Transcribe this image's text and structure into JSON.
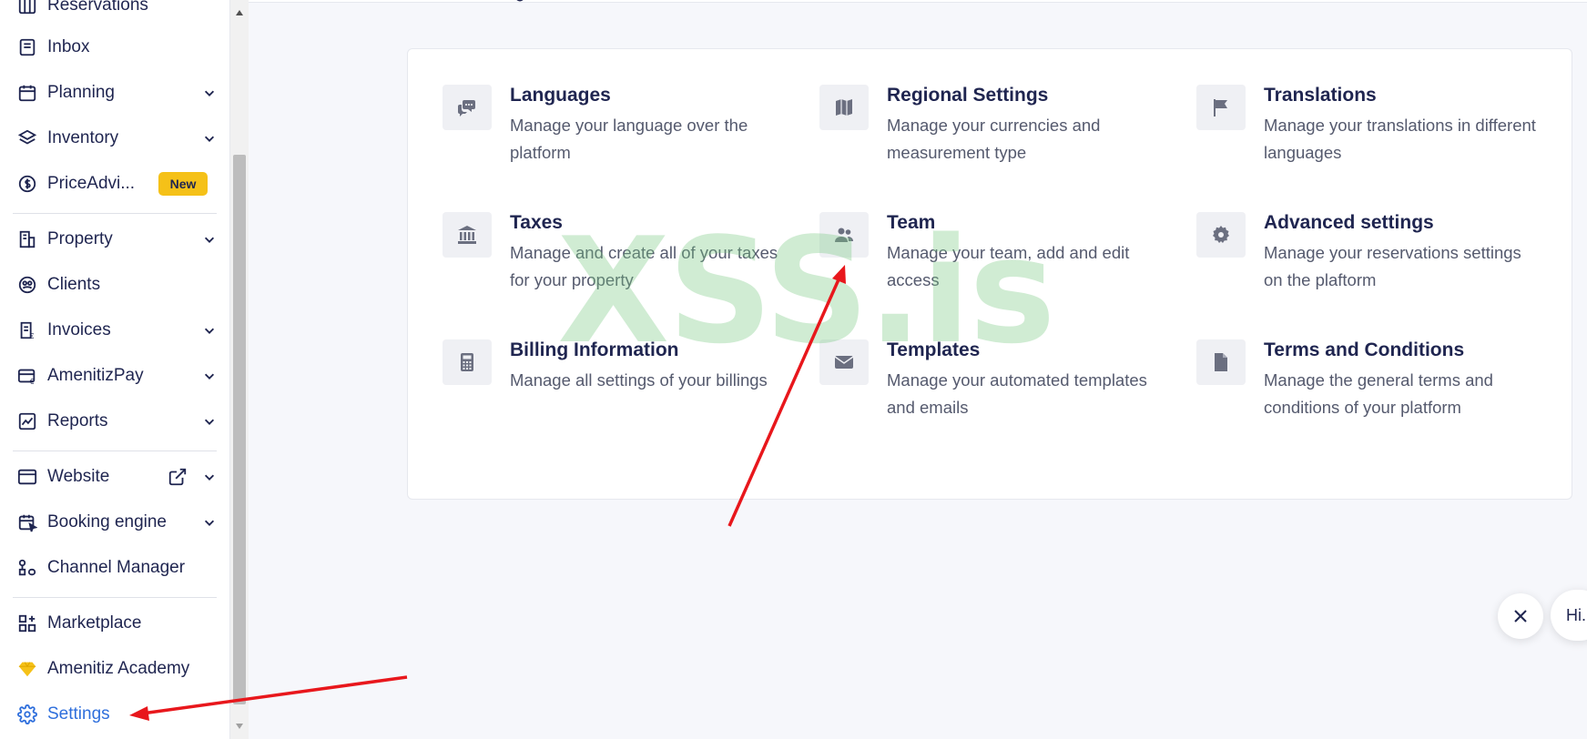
{
  "sidebar": {
    "items": [
      {
        "label": "Reservations",
        "icon": "reservations-icon"
      },
      {
        "label": "Inbox",
        "icon": "inbox-icon"
      },
      {
        "label": "Planning",
        "icon": "calendar-icon"
      },
      {
        "label": "Inventory",
        "icon": "layers-icon"
      },
      {
        "label": "PriceAdvi...",
        "icon": "dollar-circle-icon",
        "badge": "New"
      },
      {
        "label": "Property",
        "icon": "building-icon"
      },
      {
        "label": "Clients",
        "icon": "clients-icon"
      },
      {
        "label": "Invoices",
        "icon": "invoice-icon"
      },
      {
        "label": "AmenitizPay",
        "icon": "card-euro-icon"
      },
      {
        "label": "Reports",
        "icon": "chart-icon"
      },
      {
        "label": "Website",
        "icon": "browser-icon"
      },
      {
        "label": "Booking engine",
        "icon": "calendar-cursor-icon"
      },
      {
        "label": "Channel Manager",
        "icon": "channel-icon"
      },
      {
        "label": "Marketplace",
        "icon": "grid-plus-icon"
      },
      {
        "label": "Amenitiz Academy",
        "icon": "diamond-icon"
      },
      {
        "label": "Settings",
        "icon": "gear-icon"
      }
    ]
  },
  "settings_tiles": [
    {
      "title": "Languages",
      "description": "Manage your language over the platform",
      "icon": "chat-bubble-icon"
    },
    {
      "title": "Regional Settings",
      "description": "Manage your currencies and measurement type",
      "icon": "map-icon"
    },
    {
      "title": "Translations",
      "description": "Manage your translations in different languages",
      "icon": "flag-icon"
    },
    {
      "title": "Taxes",
      "description": "Manage and create all of your taxes for your property",
      "icon": "bank-icon"
    },
    {
      "title": "Team",
      "description": "Manage your team, add and edit access",
      "icon": "users-icon"
    },
    {
      "title": "Advanced settings",
      "description": "Manage your reservations settings on the plaftorm",
      "icon": "cog-icon"
    },
    {
      "title": "Billing Information",
      "description": "Manage all settings of your billings",
      "icon": "calculator-icon"
    },
    {
      "title": "Templates",
      "description": "Manage your automated templates and emails",
      "icon": "envelope-icon"
    },
    {
      "title": "Terms and Conditions",
      "description": "Manage the general terms and conditions of your platform",
      "icon": "document-icon"
    }
  ],
  "watermark": "XSS.is",
  "chat": {
    "greeting": "Hi."
  },
  "colors": {
    "accent": "#2f6fdc",
    "badge": "#f5c118",
    "arrow": "#e8171c",
    "text": "#1f2550"
  }
}
